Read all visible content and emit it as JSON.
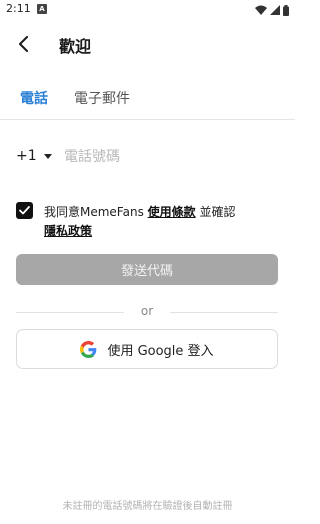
{
  "status_bar": {
    "time": "2:11",
    "notification_badge": "A"
  },
  "app_bar": {
    "title": "歡迎",
    "back_icon": "back-arrow-icon"
  },
  "tabs": [
    {
      "label": "電話",
      "active": true
    },
    {
      "label": "電子郵件",
      "active": false
    }
  ],
  "phone": {
    "country_code": "+1",
    "placeholder": "電話號碼",
    "value": ""
  },
  "agreement": {
    "checked": true,
    "prefix": "我同意MemeFans ",
    "terms_link": "使用條款",
    "middle": " 並確認",
    "privacy_link": "隱私政策"
  },
  "send_button": {
    "label": "發送代碼",
    "enabled": false
  },
  "divider": {
    "label": "or"
  },
  "google_button": {
    "label": "使用 Google 登入"
  },
  "footer": {
    "note": "未註冊的電話號碼將在驗證後自動註冊"
  },
  "colors": {
    "accent": "#2b80d6",
    "disabled_button": "#a7a7a7"
  }
}
